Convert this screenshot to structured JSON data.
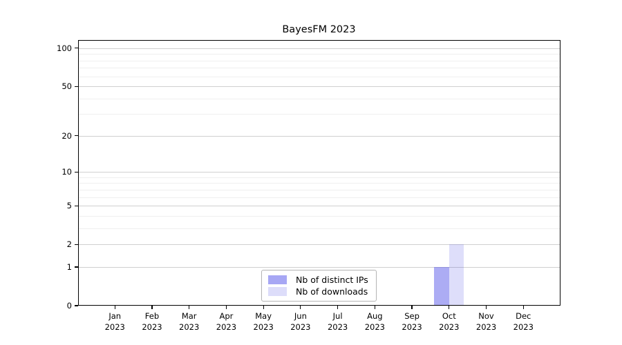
{
  "chart_data": {
    "type": "bar",
    "title": "BayesFM 2023",
    "x_ticks": [
      {
        "line1": "Jan",
        "line2": "2023"
      },
      {
        "line1": "Feb",
        "line2": "2023"
      },
      {
        "line1": "Mar",
        "line2": "2023"
      },
      {
        "line1": "Apr",
        "line2": "2023"
      },
      {
        "line1": "May",
        "line2": "2023"
      },
      {
        "line1": "Jun",
        "line2": "2023"
      },
      {
        "line1": "Jul",
        "line2": "2023"
      },
      {
        "line1": "Aug",
        "line2": "2023"
      },
      {
        "line1": "Sep",
        "line2": "2023"
      },
      {
        "line1": "Oct",
        "line2": "2023"
      },
      {
        "line1": "Nov",
        "line2": "2023"
      },
      {
        "line1": "Dec",
        "line2": "2023"
      }
    ],
    "series": [
      {
        "name": "Nb of distinct IPs",
        "color": "#a7a7f4",
        "bar_fill": "rgba(70,70,230,0.45)",
        "values": [
          0,
          0,
          0,
          0,
          0,
          0,
          0,
          0,
          0,
          1,
          0,
          0
        ]
      },
      {
        "name": "Nb of downloads",
        "color": "#ddddfa",
        "bar_fill": "rgba(70,70,230,0.18)",
        "values": [
          0,
          0,
          0,
          0,
          0,
          0,
          0,
          0,
          0,
          2,
          0,
          0
        ]
      }
    ],
    "y_axis": {
      "scale": "log1p",
      "tick_labels": [
        "0",
        "1",
        "2",
        "5",
        "10",
        "20",
        "50",
        "100"
      ],
      "tick_values": [
        0,
        1,
        2,
        5,
        10,
        20,
        50,
        100
      ],
      "major_gridlines": [
        1,
        2,
        5,
        10,
        20,
        50,
        100
      ],
      "minor_gridlines": [
        3,
        4,
        6,
        7,
        8,
        9,
        30,
        40,
        60,
        70,
        80,
        90
      ],
      "range_top_value": 116,
      "ylim": [
        0,
        100
      ]
    },
    "legend": {
      "position": "lower center"
    },
    "grid": "on"
  }
}
